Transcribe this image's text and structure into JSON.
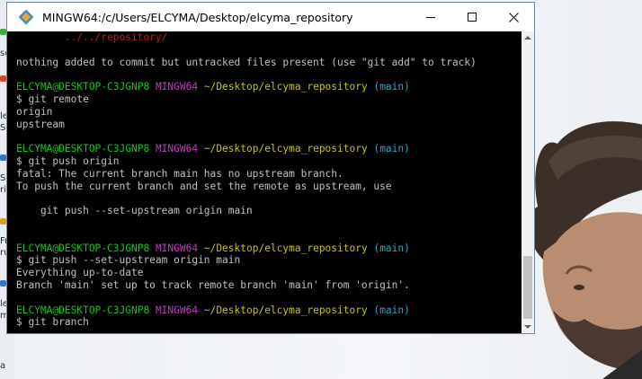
{
  "window": {
    "title": "MINGW64:/c/Users/ELCYMA/Desktop/elcyma_repository",
    "buttons": {
      "minimize": "—",
      "maximize": "☐",
      "close": "✕"
    }
  },
  "colors": {
    "path_red": "#bf1d1d",
    "user_green": "#19c419",
    "mingw_magenta": "#c03cc0",
    "dir_yellow": "#c1c12a",
    "branch_cyan": "#2aa8c1",
    "text_gray": "#c0c0c0"
  },
  "desktop": {
    "left_labels": [
      "sof",
      "le",
      "S",
      "Scri",
      "ri",
      "Fre",
      "rus",
      "le",
      "me",
      "a"
    ]
  },
  "prompt": {
    "user": "ELCYMA@DESKTOP-C3JGNP8",
    "env": "MINGW64",
    "dir": "~/Desktop/elcyma_repository",
    "branch": "(main)"
  },
  "terminal": {
    "l01": "        ../../repository/",
    "l02": "",
    "l03": "nothing added to commit but untracked files present (use \"git add\" to track)",
    "l04": "",
    "l06": "$ git remote",
    "l07": "origin",
    "l08": "upstream",
    "l09": "",
    "l11": "$ git push origin",
    "l12": "fatal: The current branch main has no upstream branch.",
    "l13": "To push the current branch and set the remote as upstream, use",
    "l14": "",
    "l15": "    git push --set-upstream origin main",
    "l16": "",
    "l17": "",
    "l19": "$ git push --set-upstream origin main",
    "l20": "Everything up-to-date",
    "l21": "Branch 'main' set up to track remote branch 'main' from 'origin'.",
    "l22": "",
    "l24": "$ git branch"
  }
}
